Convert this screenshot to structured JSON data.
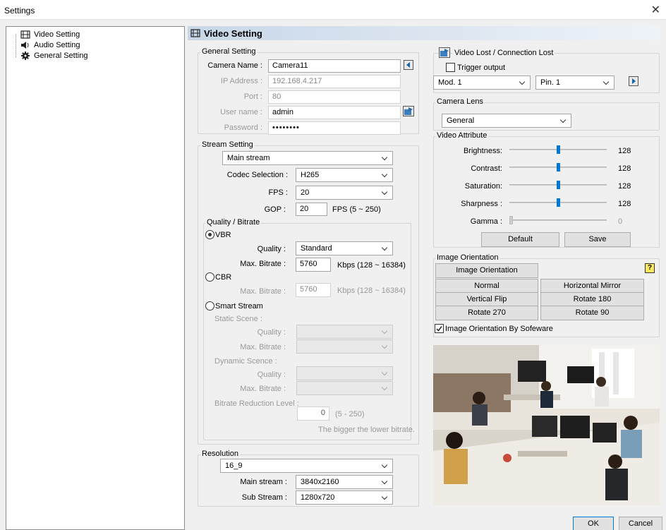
{
  "window": {
    "title": "Settings"
  },
  "tree": {
    "items": [
      {
        "label": "Video Setting"
      },
      {
        "label": "Audio Setting"
      },
      {
        "label": "General Setting"
      }
    ]
  },
  "header": {
    "title": "Video Setting"
  },
  "general": {
    "group_label": "General Setting",
    "camera_name_label": "Camera Name :",
    "camera_name": "Camera11",
    "ip_label": "IP Address :",
    "ip": "192.168.4.217",
    "port_label": "Port :",
    "port": "80",
    "user_label": "User name :",
    "user": "admin",
    "password_label": "Password :",
    "password": "••••••••"
  },
  "stream": {
    "group_label": "Stream Setting",
    "stream_type": "Main stream",
    "codec_label": "Codec Selection :",
    "codec": "H265",
    "fps_label": "FPS :",
    "fps": "20",
    "gop_label": "GOP :",
    "gop": "20",
    "gop_hint": "FPS (5 ~ 250)",
    "quality_group": "Quality / Bitrate",
    "vbr_label": "VBR",
    "quality_label": "Quality :",
    "quality": "Standard",
    "max_bitrate_label": "Max. Bitrate :",
    "max_bitrate": "5760",
    "bitrate_hint": "Kbps (128 ~ 16384)",
    "cbr_label": "CBR",
    "cbr_max_label": "Max. Bitrate :",
    "cbr_max": "5760",
    "cbr_hint": "Kbps (128 ~ 16384)",
    "smart_label": "Smart Stream",
    "static_scene": "Static Scene :",
    "static_quality_label": "Quality :",
    "static_bitrate_label": "Max. Bitrate :",
    "dynamic_scene": "Dynamic Scence :",
    "dynamic_quality_label": "Quality :",
    "dynamic_bitrate_label": "Max. Bitrate :",
    "reduction_label": "Bitrate Reduction Level :",
    "reduction_value": "0",
    "reduction_hint": "(5 - 250)",
    "reduction_note": "The bigger the lower bitrate."
  },
  "resolution": {
    "group_label": "Resolution",
    "aspect": "16_9",
    "main_label": "Main stream :",
    "main": "3840x2160",
    "sub_label": "Sub Stream :",
    "sub": "1280x720"
  },
  "videolost": {
    "group_label": "Video Lost / Connection Lost",
    "trigger_label": "Trigger output",
    "module": "Mod. 1",
    "pin": "Pin. 1"
  },
  "lens": {
    "group_label": "Camera Lens",
    "value": "General"
  },
  "attributes": {
    "group_label": "Video Attribute",
    "items": [
      {
        "label": "Brightness:",
        "value": "128",
        "level": 0.5
      },
      {
        "label": "Contrast:",
        "value": "128",
        "level": 0.5
      },
      {
        "label": "Saturation:",
        "value": "128",
        "level": 0.5
      },
      {
        "label": "Sharpness :",
        "value": "128",
        "level": 0.5
      },
      {
        "label": "Gamma :",
        "value": "0",
        "level": 0
      }
    ],
    "default_label": "Default",
    "save_label": "Save"
  },
  "orientation": {
    "group_label": "Image Orientation",
    "header_button": "Image Orientation",
    "buttons": [
      "Normal",
      "Horizontal Mirror",
      "Vertical Flip",
      "Rotate 180",
      "Rotate 270",
      "Rotate 90"
    ],
    "software_label": "Image Orientation By Sofeware"
  },
  "footer": {
    "ok": "OK",
    "cancel": "Cancel"
  }
}
